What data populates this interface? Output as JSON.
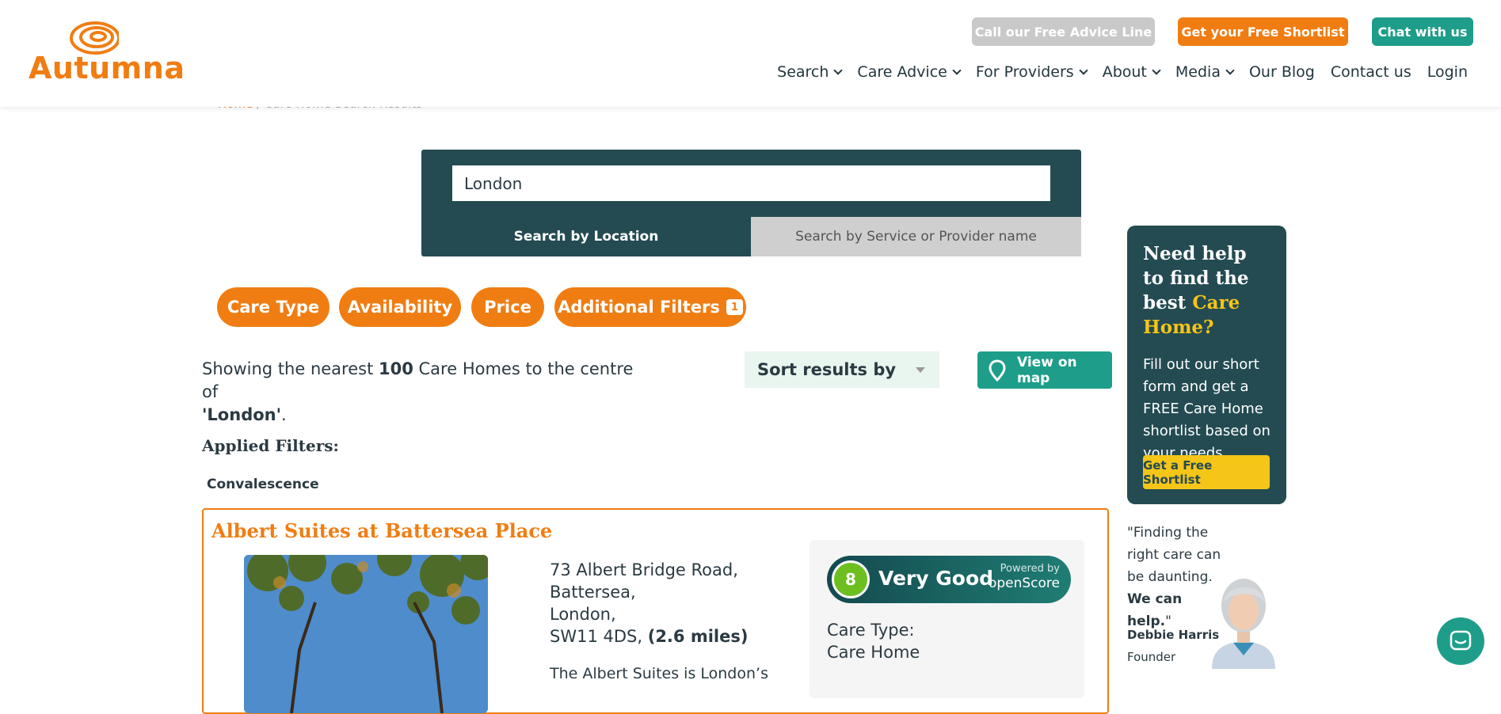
{
  "brand": {
    "name": "Autumna",
    "accent": "#f07d12",
    "teal": "#1e9e8a",
    "dark_teal": "#244b52"
  },
  "top_buttons": {
    "advice": "Call our Free Advice Line",
    "shortlist": "Get your Free Shortlist",
    "chat": "Chat with us"
  },
  "nav": {
    "search": "Search",
    "care_advice": "Care Advice",
    "providers": "For Providers",
    "about": "About",
    "media": "Media",
    "blog": "Our Blog",
    "contact": "Contact us",
    "login": "Login"
  },
  "breadcrumb": {
    "home": "Home",
    "sep": "/",
    "current": "Care Home Search Results"
  },
  "search": {
    "value": "London",
    "tab_location": "Search by Location",
    "tab_service": "Search by Service or Provider name"
  },
  "filters": {
    "care_type": "Care Type",
    "availability": "Availability",
    "price": "Price",
    "additional": "Additional Filters",
    "additional_count": "1"
  },
  "results": {
    "prefix": "Showing the nearest ",
    "count": "100",
    "middle": " Care Homes to the centre of",
    "location": "'London'",
    "suffix": "."
  },
  "sort": {
    "label": "Sort results by"
  },
  "map_button": {
    "label": "View on map"
  },
  "applied": {
    "heading": "Applied Filters:",
    "chip": "Convalescence"
  },
  "listing": {
    "title": "Albert Suites at Battersea Place",
    "address_1": "73 Albert Bridge Road,",
    "address_2": "Battersea,",
    "address_3": "London,",
    "postcode": "SW11 4DS,",
    "distance": "(2.6 miles)",
    "description": "The Albert Suites is London’s",
    "score": "8",
    "score_label": "Very Good",
    "powered_by": "Powered by",
    "openscore": "openScore",
    "care_type_label": "Care Type:",
    "care_type_value": "Care Home"
  },
  "help": {
    "heading_1": "Need help to find the best",
    "heading_2": "Care Home?",
    "body": "Fill out our short form and get a FREE Care Home shortlist based on your needs.",
    "button": "Get a Free Shortlist",
    "quote": "\"Finding the right care can be daunting.",
    "quote_bold": "We can help.",
    "quote_end": "\"",
    "founder_name": "Debbie Harris",
    "founder_role": "Founder"
  }
}
